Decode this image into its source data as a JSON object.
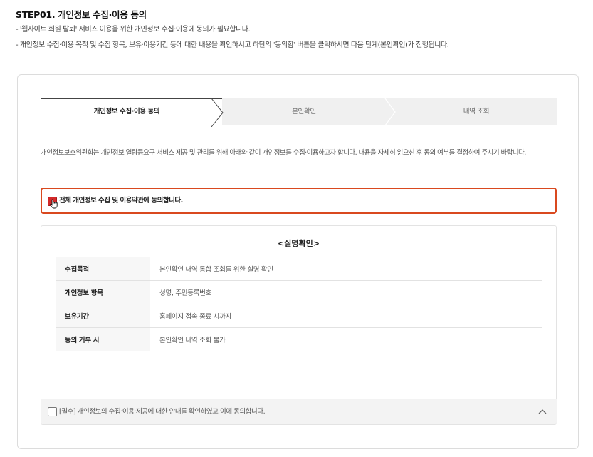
{
  "header": {
    "title": "STEP01. 개인정보 수집·이용 동의",
    "lines": [
      "- '웹사이트 회원 탈퇴' 서비스 이용을 위한 개인정보 수집·이용에 동의가 필요합니다.",
      "- 개인정보 수집·이용 목적 및 수집 항목, 보유·이용기간 등에 대한 내용을 확인하시고 하단의 '동의함' 버튼을 클릭하시면 다음 단계(본인확인)가 진행됩니다."
    ]
  },
  "steps": [
    {
      "label": "개인정보 수집·이용 동의",
      "active": true
    },
    {
      "label": "본인확인",
      "active": false
    },
    {
      "label": "내역 조회",
      "active": false
    }
  ],
  "intro": "개인정보보호위원회는 개인정보 열람등요구 서비스 제공 및 관리를 위해 아래와 같이 개인정보를 수집·이용하고자 합니다. 내용을 자세히 읽으신 후 동의 여부를 결정하여 주시기 바랍니다.",
  "agree_all": {
    "label": "전체 개인정보 수집 및 이용약관에 동의합니다.",
    "checked": true,
    "accent": "#d9491f"
  },
  "terms": {
    "title": "<실명확인>",
    "rows": [
      {
        "label": "수집목적",
        "value": "본인확인 내역 통합 조회를 위한 실명 확인"
      },
      {
        "label": "개인정보 항목",
        "value": "성명, 주민등록번호"
      },
      {
        "label": "보유기간",
        "value": "홈페이지 접속 종료 시까지"
      },
      {
        "label": "동의 거부 시",
        "value": "본인확인 내역 조회 불가"
      }
    ]
  },
  "required_agree": {
    "label": "[필수] 개인정보의 수집·이용·제공에 대한 안내를 확인하였고 이에 동의합니다.",
    "checked": false,
    "toggle_icon": "chevron-up-icon"
  }
}
